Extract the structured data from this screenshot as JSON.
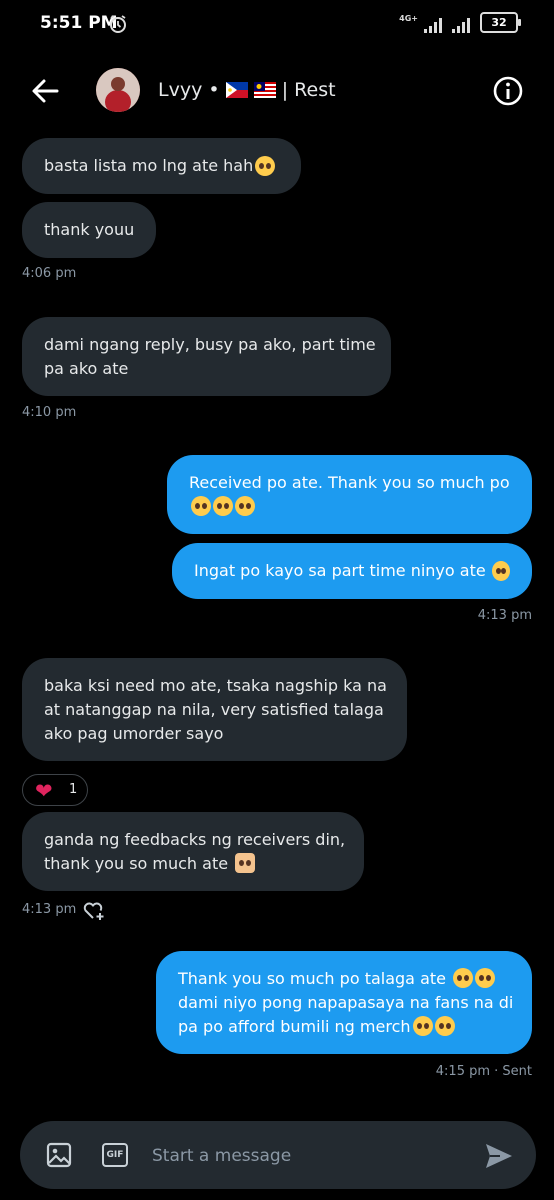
{
  "status_bar": {
    "time": "5:51 PM",
    "network": "4G+",
    "battery": "32"
  },
  "header": {
    "name": "Lvyy •",
    "name_suffix": "| Rest"
  },
  "messages": [
    {
      "text": "basta lista mo lng ate hah"
    },
    {
      "text": "thank youu"
    },
    {
      "time": "4:06 pm"
    },
    {
      "line1": "dami ngang reply, busy pa ako, part time",
      "line2": "pa ako ate"
    },
    {
      "time": "4:10 pm"
    },
    {
      "line1": "Received po ate. Thank you so much po"
    },
    {
      "text": "Ingat po kayo sa part time ninyo ate"
    },
    {
      "time": "4:13 pm"
    },
    {
      "line1": "baka ksi need mo ate, tsaka nagship ka na",
      "line2": "at natanggap na nila, very satisfied talaga",
      "line3": "ako pag umorder sayo"
    },
    {
      "line1": "ganda ng feedbacks ng receivers din,",
      "line2": "thank you so much ate"
    },
    {
      "time": "4:13 pm"
    },
    {
      "line1": "Thank you so much po talaga ate",
      "line2": "dami niyo pong napapasaya na fans na di",
      "line3": "pa po afford bumili ng merch"
    },
    {
      "time": "4:15 pm · Sent"
    }
  ],
  "reaction": {
    "count": "1"
  },
  "composer": {
    "placeholder": "Start a message",
    "gif_label": "GIF"
  },
  "colors": {
    "incoming": "#232a30",
    "outgoing": "#1d9bf0",
    "background": "#000000"
  }
}
